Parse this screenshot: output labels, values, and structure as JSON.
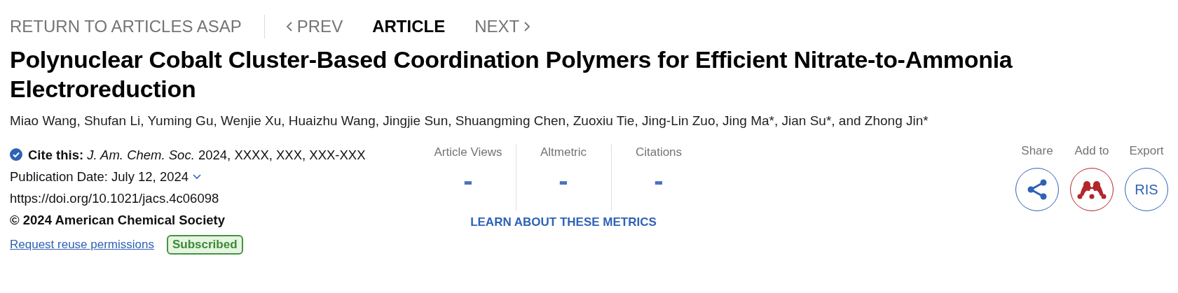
{
  "nav": {
    "return_link": "RETURN TO ARTICLES ASAP",
    "items": [
      {
        "label": "PREV",
        "kind": "prev",
        "selected": false
      },
      {
        "label": "ARTICLE",
        "kind": "current",
        "selected": true
      },
      {
        "label": "NEXT",
        "kind": "next",
        "selected": false
      }
    ]
  },
  "title": "Polynuclear Cobalt Cluster-Based Coordination Polymers for Efficient Nitrate-to-Ammonia Electroreduction",
  "authors": "Miao Wang, Shufan Li, Yuming Gu, Wenjie Xu, Huaizhu Wang, Jingjie Sun, Shuangming Chen, Zuoxiu Tie, Jing-Lin Zuo, Jing Ma*, Jian Su*, and Zhong Jin*",
  "citation": {
    "text": "**Cite this:** *J. Am. Chem. Soc.*  2024, XXXX, XXX, XXX-XXX",
    "publication_date": "Publication Date: July 12, 2024",
    "doi": "https://doi.org/10.1021/jacs.4c06098",
    "copyright": "© 2024 American Chemical Society",
    "permissions_link": "Request reuse permissions",
    "access_badge": "Subscribed"
  },
  "metrics": {
    "items": [
      {
        "label": "Article Views",
        "value": "-"
      },
      {
        "label": "Altmetric",
        "value": "-"
      },
      {
        "label": "Citations",
        "value": "-"
      }
    ],
    "learn_link": "LEARN ABOUT THESE METRICS"
  },
  "actions": [
    {
      "label": "Share",
      "kind": "share"
    },
    {
      "label": "Add to",
      "kind": "mendeley"
    },
    {
      "label": "Export",
      "kind": "ris",
      "button_text": "RIS"
    }
  ]
}
